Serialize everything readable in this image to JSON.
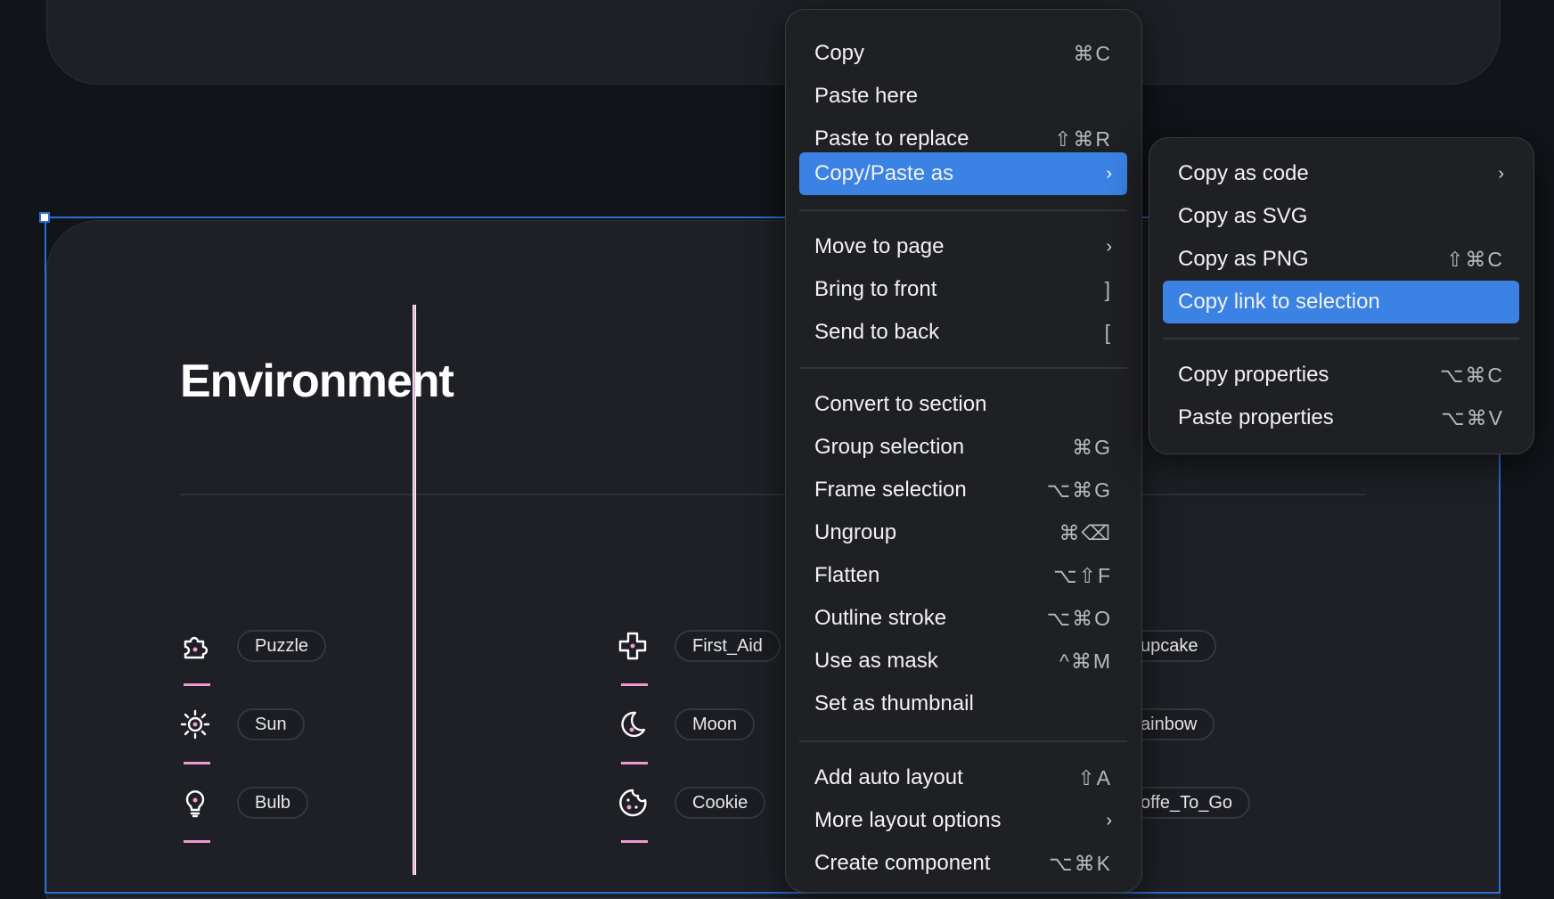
{
  "canvas": {
    "frame_title": "Environment",
    "icons": [
      {
        "label": "Puzzle",
        "icon": "puzzle-icon"
      },
      {
        "label": "Sun",
        "icon": "sun-icon"
      },
      {
        "label": "Bulb",
        "icon": "bulb-icon"
      },
      {
        "label": "First_Aid",
        "icon": "first-aid-icon"
      },
      {
        "label": "Moon",
        "icon": "moon-icon"
      },
      {
        "label": "Cookie",
        "icon": "cookie-icon"
      },
      {
        "label": "upcake"
      },
      {
        "label": "ainbow"
      },
      {
        "label": "offe_To_Go"
      }
    ]
  },
  "context_menu": {
    "items": [
      {
        "label": "Copy",
        "shortcut": "⌘C"
      },
      {
        "label": "Paste here",
        "shortcut": ""
      },
      {
        "label": "Paste to replace",
        "shortcut": "⇧⌘R"
      },
      {
        "label": "Copy/Paste as",
        "submenu": true,
        "active": true
      },
      {
        "label": "Move to page",
        "submenu": true
      },
      {
        "label": "Bring to front",
        "shortcut": "]"
      },
      {
        "label": "Send to back",
        "shortcut": "["
      },
      {
        "label": "Convert to section",
        "shortcut": ""
      },
      {
        "label": "Group selection",
        "shortcut": "⌘G"
      },
      {
        "label": "Frame selection",
        "shortcut": "⌥⌘G"
      },
      {
        "label": "Ungroup",
        "shortcut": "⌘⌫"
      },
      {
        "label": "Flatten",
        "shortcut": "⌥⇧F"
      },
      {
        "label": "Outline stroke",
        "shortcut": "⌥⌘O"
      },
      {
        "label": "Use as mask",
        "shortcut": "^⌘M"
      },
      {
        "label": "Set as thumbnail",
        "shortcut": ""
      },
      {
        "label": "Add auto layout",
        "shortcut": "⇧A"
      },
      {
        "label": "More layout options",
        "submenu": true
      },
      {
        "label": "Create component",
        "shortcut": "⌥⌘K"
      }
    ]
  },
  "submenu": {
    "items": [
      {
        "label": "Copy as code",
        "submenu": true
      },
      {
        "label": "Copy as SVG",
        "shortcut": ""
      },
      {
        "label": "Copy as PNG",
        "shortcut": "⇧⌘C"
      },
      {
        "label": "Copy link to selection",
        "active": true
      },
      {
        "label": "Copy properties",
        "shortcut": "⌥⌘C"
      },
      {
        "label": "Paste properties",
        "shortcut": "⌥⌘V"
      }
    ]
  },
  "colors": {
    "accent": "#3a82e4",
    "selection": "#2a6fd6",
    "icon_pink": "#f09ad2",
    "background": "#111419"
  }
}
